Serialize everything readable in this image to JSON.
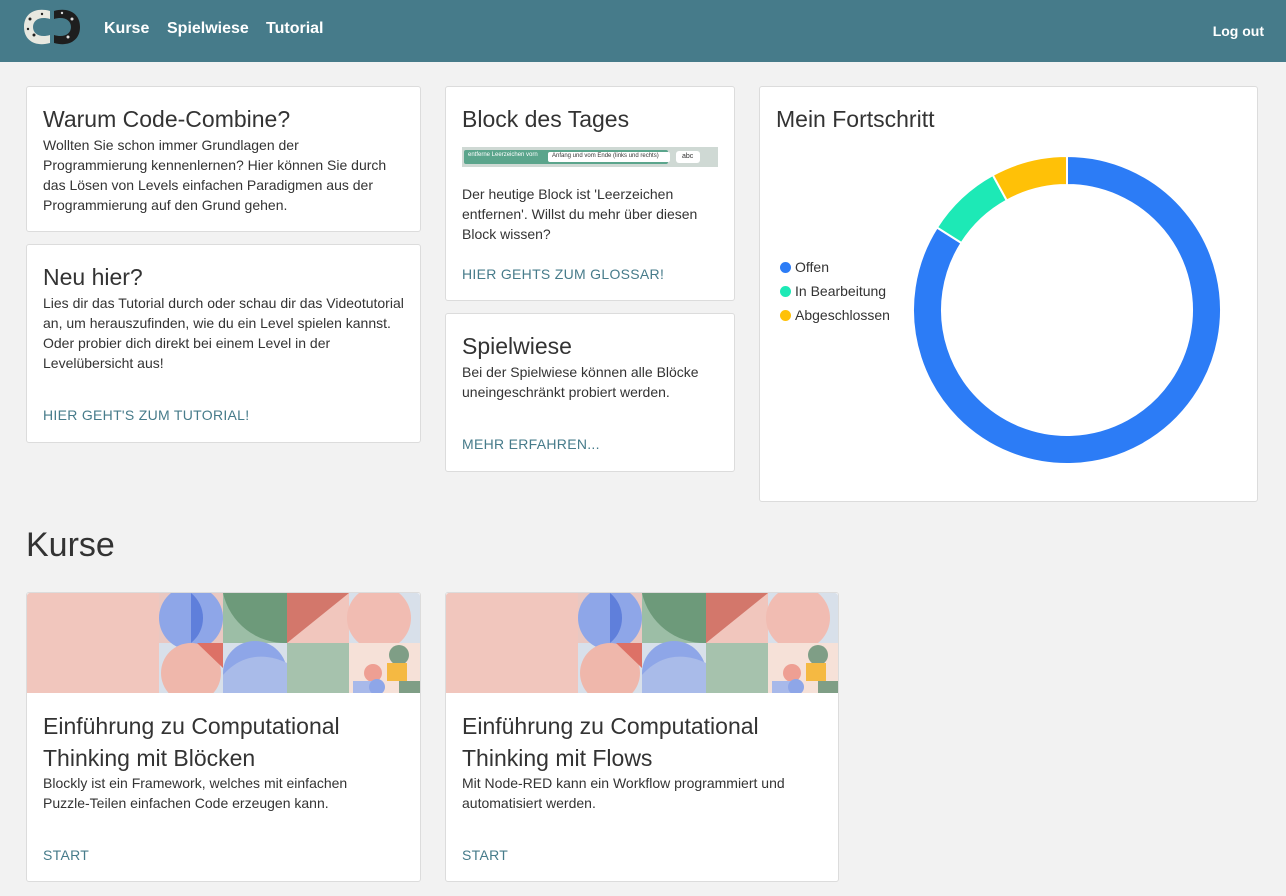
{
  "nav": {
    "links": [
      "Kurse",
      "Spielwiese",
      "Tutorial"
    ],
    "logout": "Log out"
  },
  "why": {
    "title": "Warum Code-Combine?",
    "text": "Wollten Sie schon immer Grundlagen der Programmierung kennenlernen? Hier können Sie durch das Lösen von Levels einfachen Paradigmen aus der Programmierung auf den Grund gehen."
  },
  "new": {
    "title": "Neu hier?",
    "text": "Lies dir das Tutorial durch oder schau dir das Videotutorial an, um herauszufinden, wie du ein Level spielen kannst. Oder probier dich direkt bei einem Level in der Levelübersicht aus!",
    "link": "HIER GEHT'S ZUM TUTORIAL!"
  },
  "block": {
    "title": "Block des Tages",
    "block_label": "entferne Leerzeichen vorn",
    "block_slot": "Anfang und vom Ende (links und rechts)",
    "block_value": "abc",
    "text": "Der heutige Block ist 'Leerzeichen entfernen'. Willst du mehr über diesen Block wissen?",
    "link": "HIER GEHTS ZUM GLOSSAR!"
  },
  "spielwiese": {
    "title": "Spielwiese",
    "text": "Bei der Spielwiese können alle Blöcke uneingeschränkt probiert werden.",
    "link": "MEHR ERFAHREN..."
  },
  "progress": {
    "title": "Mein Fortschritt"
  },
  "chart_data": {
    "type": "pie",
    "style": "donut",
    "categories": [
      "Offen",
      "In Bearbeitung",
      "Abgeschlossen"
    ],
    "values": [
      84,
      8,
      8
    ],
    "colors": [
      "#2c7cf6",
      "#1de9b6",
      "#ffc107"
    ],
    "legend": "left"
  },
  "courses": {
    "title": "Kurse",
    "items": [
      {
        "title": "Einführung zu Computational Thinking mit Blöcken",
        "text": "Blockly ist ein Framework, welches mit einfachen Puzzle-Teilen einfachen Code erzeugen kann.",
        "link": "START"
      },
      {
        "title": "Einführung zu Computational Thinking mit Flows",
        "text": "Mit Node-RED kann ein Workflow programmiert und automatisiert werden.",
        "link": "START"
      }
    ]
  }
}
